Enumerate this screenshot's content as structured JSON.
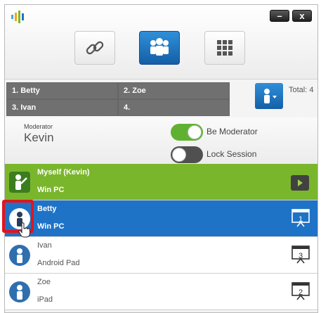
{
  "window": {
    "minimize_label": "–",
    "close_label": "x",
    "app_icon": "app-logo-icon"
  },
  "modes": [
    {
      "name": "link",
      "icon": "link-icon",
      "active": false
    },
    {
      "name": "group",
      "icon": "group-icon",
      "active": true
    },
    {
      "name": "grid",
      "icon": "grid-icon",
      "active": false
    }
  ],
  "participants_grid": {
    "cells": [
      "1. Betty",
      "2. Zoe",
      "3. Ivan",
      "4."
    ],
    "total": "Total: 4"
  },
  "moderator": {
    "label": "Moderator",
    "name": "Kevin",
    "be_moderator": {
      "label": "Be Moderator",
      "on": true
    },
    "lock_session": {
      "label": "Lock Session",
      "on": false
    }
  },
  "list": [
    {
      "name": "Myself (Kevin)",
      "device": "Win PC",
      "state": "me",
      "right": "play-icon"
    },
    {
      "name": "Betty",
      "device": "Win PC",
      "state": "selected",
      "screen": "1"
    },
    {
      "name": "Ivan",
      "device": "Android Pad",
      "state": "normal",
      "screen": "3"
    },
    {
      "name": "Zoe",
      "device": "iPad",
      "state": "normal",
      "screen": "2"
    }
  ],
  "colors": {
    "accent_blue": "#1e73c7",
    "self_green": "#7ab62c",
    "toggle_on": "#5fb231",
    "highlight_red": "#e3141c"
  }
}
